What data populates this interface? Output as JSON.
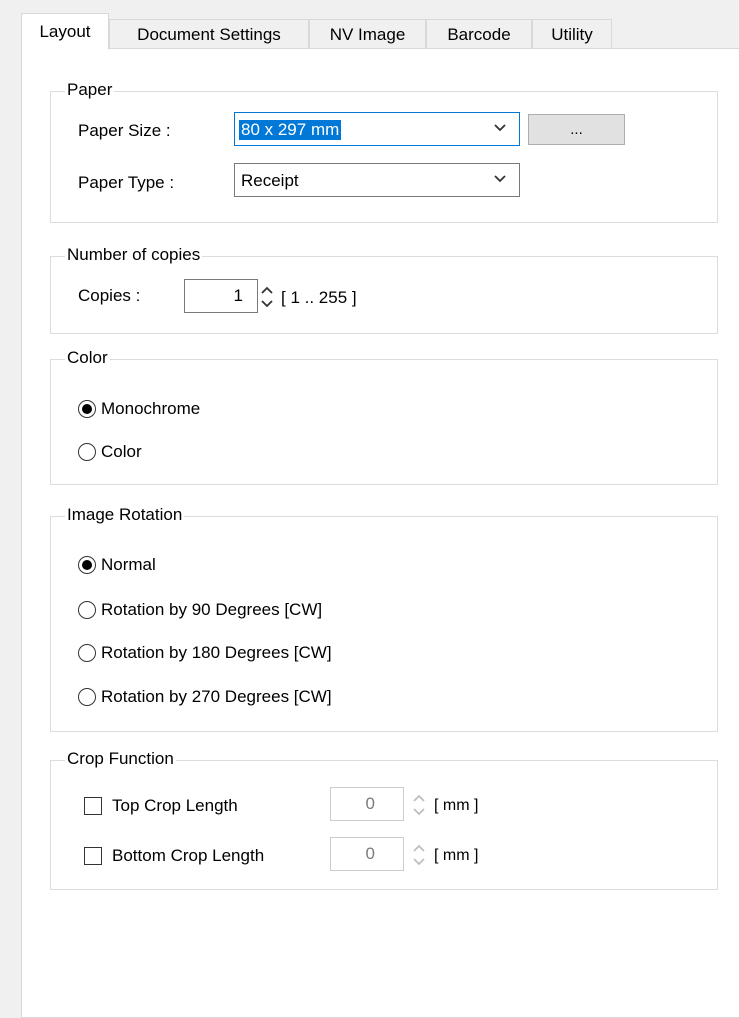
{
  "tabs": [
    {
      "label": "Layout",
      "active": true
    },
    {
      "label": "Document Settings",
      "active": false
    },
    {
      "label": "NV Image",
      "active": false
    },
    {
      "label": "Barcode",
      "active": false
    },
    {
      "label": "Utility",
      "active": false
    }
  ],
  "paper": {
    "legend": "Paper",
    "size_label": "Paper Size :",
    "size_value": "80 x 297 mm",
    "browse_label": "...",
    "type_label": "Paper Type :",
    "type_value": "Receipt"
  },
  "copies": {
    "legend": "Number of copies",
    "label": "Copies :",
    "value": "1",
    "range": "[ 1 .. 255 ]"
  },
  "color": {
    "legend": "Color",
    "options": [
      {
        "label": "Monochrome",
        "selected": true
      },
      {
        "label": "Color",
        "selected": false
      }
    ]
  },
  "rotation": {
    "legend": "Image Rotation",
    "options": [
      {
        "label": "Normal",
        "selected": true
      },
      {
        "label": "Rotation by 90 Degrees [CW]",
        "selected": false
      },
      {
        "label": "Rotation by 180 Degrees [CW]",
        "selected": false
      },
      {
        "label": "Rotation by 270 Degrees [CW]",
        "selected": false
      }
    ]
  },
  "crop": {
    "legend": "Crop Function",
    "top_label": "Top Crop Length",
    "top_value": "0",
    "top_unit": "[ mm ]",
    "bottom_label": "Bottom Crop Length",
    "bottom_value": "0",
    "bottom_unit": "[ mm ]"
  }
}
